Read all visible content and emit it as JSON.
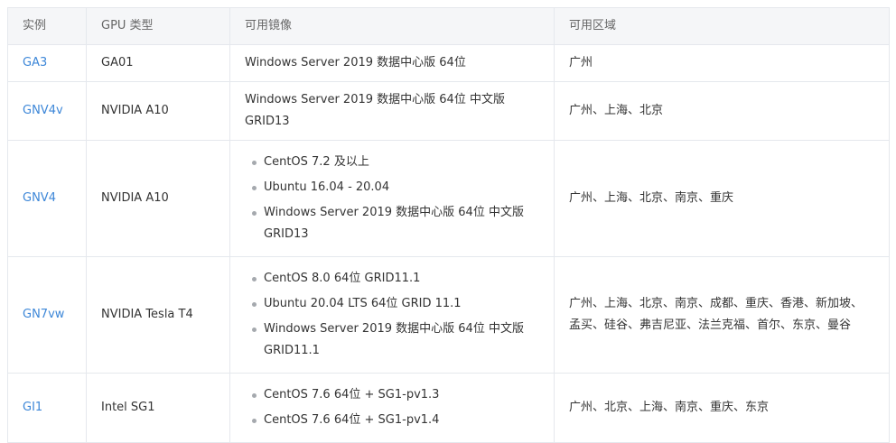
{
  "headers": {
    "instance": "实例",
    "gpu_type": "GPU 类型",
    "images": "可用镜像",
    "regions": "可用区域"
  },
  "rows": [
    {
      "instance": "GA3",
      "gpu": "GA01",
      "image": "Windows Server 2019 数据中心版 64位",
      "regions": "广州"
    },
    {
      "instance": "GNV4v",
      "gpu": "NVIDIA A10",
      "image": "Windows Server 2019 数据中心版 64位 中文版 GRID13",
      "regions": "广州、上海、北京"
    },
    {
      "instance": "GNV4",
      "gpu": "NVIDIA A10",
      "images": [
        "CentOS 7.2 及以上",
        "Ubuntu 16.04 - 20.04",
        "Windows Server 2019 数据中心版 64位 中文版 GRID13"
      ],
      "regions": "广州、上海、北京、南京、重庆"
    },
    {
      "instance": "GN7vw",
      "gpu": "NVIDIA Tesla T4",
      "images": [
        "CentOS 8.0 64位 GRID11.1",
        "Ubuntu 20.04 LTS 64位 GRID 11.1",
        "Windows Server 2019 数据中心版 64位 中文版 GRID11.1"
      ],
      "regions": "广州、上海、北京、南京、成都、重庆、香港、新加坡、孟买、硅谷、弗吉尼亚、法兰克福、首尔、东京、曼谷"
    },
    {
      "instance": "GI1",
      "gpu": "Intel SG1",
      "images": [
        "CentOS 7.6 64位 + SG1-pv1.3",
        "CentOS 7.6 64位 + SG1-pv1.4"
      ],
      "regions": "广州、北京、上海、南京、重庆、东京"
    }
  ],
  "colors": {
    "link": "#3d87d8",
    "header_bg": "#f5f6f8",
    "border": "#e5e8ed",
    "bullet": "#a5a9ae"
  }
}
